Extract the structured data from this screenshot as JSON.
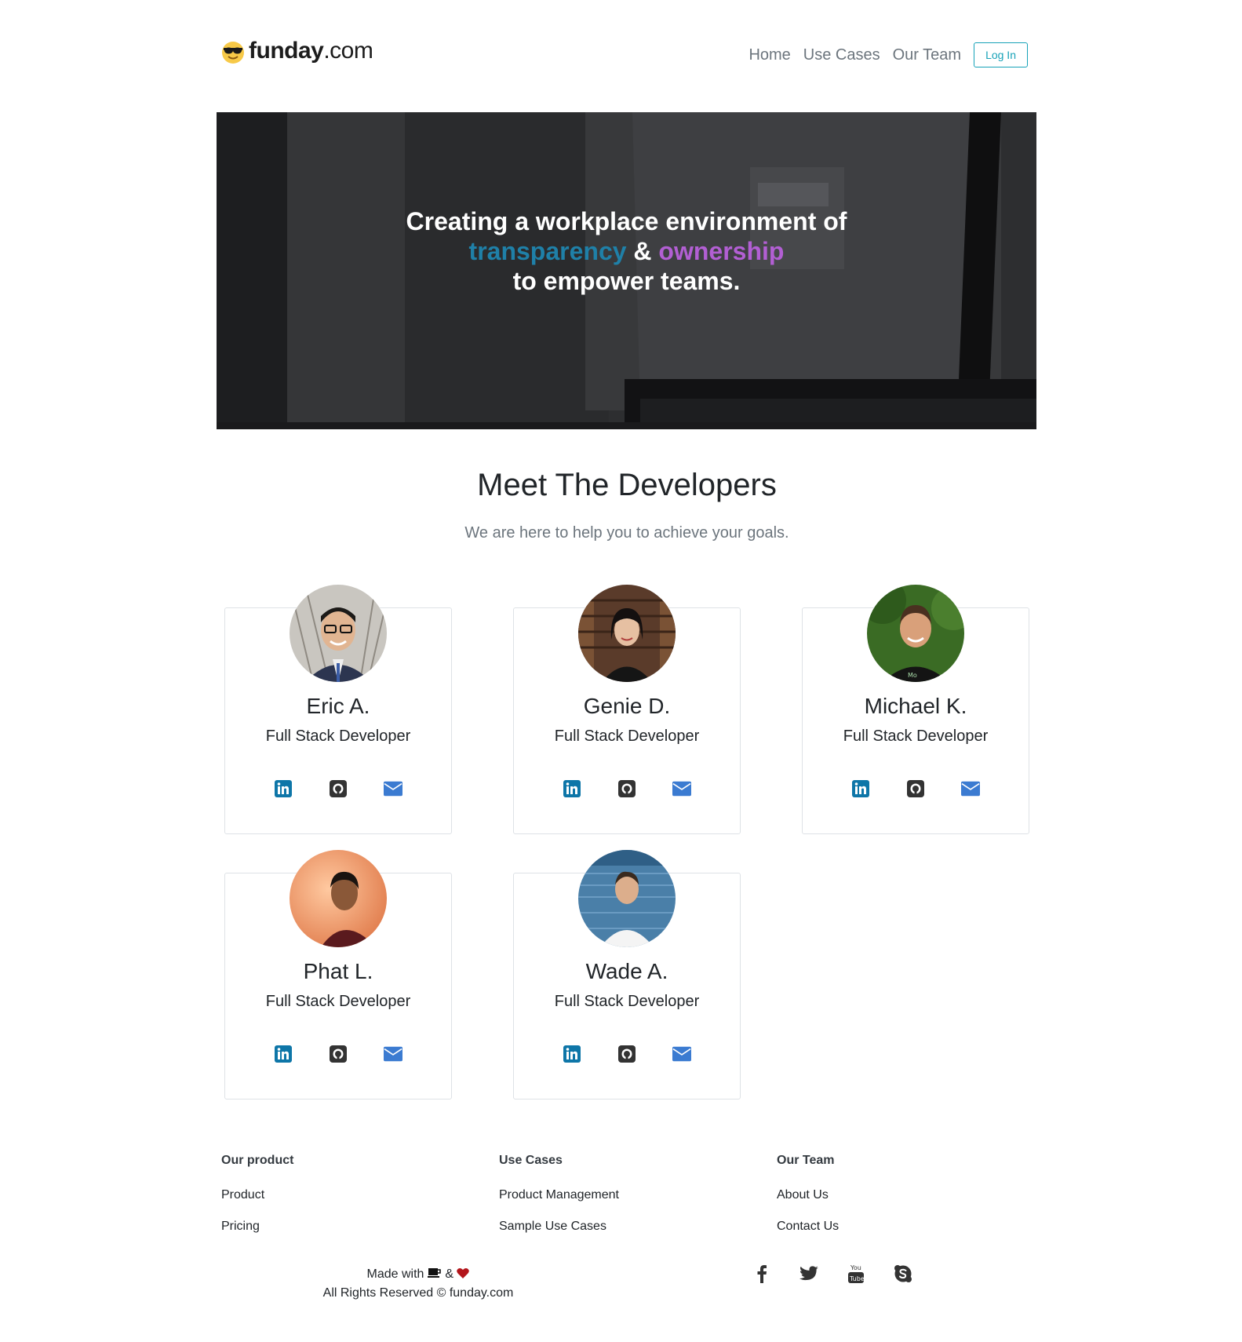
{
  "nav": {
    "logo_bold": "funday",
    "logo_light": ".com",
    "links": [
      "Home",
      "Use Cases",
      "Our Team"
    ],
    "login_label": "Log In"
  },
  "hero": {
    "line1": "Creating a workplace environment of",
    "word_transparency": "transparency",
    "amp": " & ",
    "word_ownership": "ownership",
    "line3": "to empower teams.",
    "colors": {
      "transparency": "#1f80a8",
      "ownership": "#b25fd3"
    }
  },
  "section": {
    "title": "Meet The Developers",
    "subtitle": "We are here to help you to achieve your goals."
  },
  "developers": [
    {
      "name": "Eric A.",
      "role": "Full Stack Developer"
    },
    {
      "name": "Genie D.",
      "role": "Full Stack Developer"
    },
    {
      "name": "Michael K.",
      "role": "Full Stack Developer"
    },
    {
      "name": "Phat L.",
      "role": "Full Stack Developer"
    },
    {
      "name": "Wade A.",
      "role": "Full Stack Developer"
    }
  ],
  "card_icons": [
    "linkedin-icon",
    "github-icon",
    "envelope-icon"
  ],
  "footer": {
    "columns": [
      {
        "heading": "Our product",
        "links": [
          "Product",
          "Pricing"
        ]
      },
      {
        "heading": "Use Cases",
        "links": [
          "Product Management",
          "Sample Use Cases"
        ]
      },
      {
        "heading": "Our Team",
        "links": [
          "About Us",
          "Contact Us"
        ]
      }
    ],
    "made_with": "Made with",
    "made_amp": "&",
    "rights": "All Rights Reserved © funday.com",
    "social": [
      "facebook-icon",
      "twitter-icon",
      "youtube-icon",
      "skype-icon"
    ]
  },
  "colors": {
    "accent": "#17a2b8",
    "linkedin": "#0e76a8",
    "email": "#3b7bd1",
    "heart": "#b3151b"
  }
}
